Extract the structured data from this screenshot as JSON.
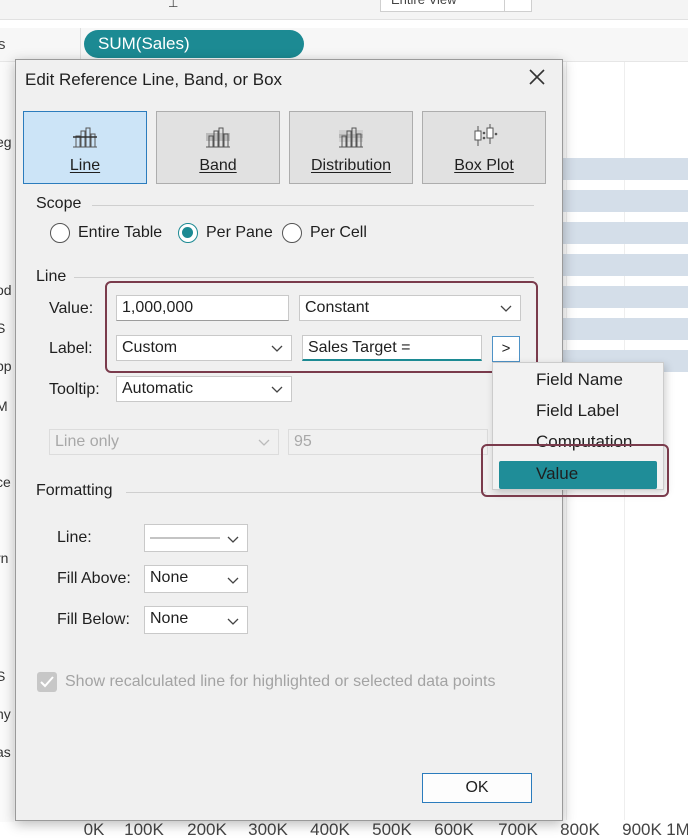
{
  "background": {
    "shelf_pill": "SUM(Sales)",
    "shelf_label_partial": "s",
    "left_labels_partial": [
      "eg",
      "od",
      "S",
      "pp",
      "M",
      "ce",
      "rn",
      "S",
      "ny",
      "as"
    ],
    "axis_ticks": [
      "0K",
      "100K",
      "200K",
      "300K",
      "400K",
      "500K",
      "600K",
      "700K",
      "800K",
      "900K",
      "1M"
    ]
  },
  "dialog": {
    "title": "Edit Reference Line, Band, or Box",
    "types": [
      {
        "label": "Line",
        "icon": "line-icon",
        "active": true
      },
      {
        "label": "Band",
        "icon": "band-icon",
        "active": false
      },
      {
        "label": "Distribution",
        "icon": "distribution-icon",
        "active": false
      },
      {
        "label": "Box Plot",
        "icon": "box-plot-icon",
        "active": false
      }
    ],
    "scope": {
      "heading": "Scope",
      "options": [
        {
          "label": "Entire Table",
          "selected": false
        },
        {
          "label": "Per Pane",
          "selected": true
        },
        {
          "label": "Per Cell",
          "selected": false
        }
      ]
    },
    "line": {
      "heading": "Line",
      "value_label": "Value:",
      "value_input": "1,000,000",
      "value_type": "Constant",
      "label_label": "Label:",
      "label_type": "Custom",
      "label_text": "Sales Target =",
      "insert_button": ">",
      "tooltip_label": "Tooltip:",
      "tooltip_value": "Automatic",
      "confidence_select": "Line only",
      "confidence_value": "95"
    },
    "formatting": {
      "heading": "Formatting",
      "line_label": "Line:",
      "fill_above_label": "Fill Above:",
      "fill_above_value": "None",
      "fill_below_label": "Fill Below:",
      "fill_below_value": "None"
    },
    "recalc_checkbox": "Show recalculated line for highlighted or selected data points",
    "ok_button": "OK"
  },
  "insert_menu": {
    "items": [
      "Field Name",
      "Field Label",
      "Computation",
      "Value"
    ],
    "selected": "Value"
  },
  "colors": {
    "accent": "#1c8a93",
    "highlight_outline": "#7a3b4c",
    "active_tab": "#cce4f7",
    "bar_fill": "#d4dee9"
  }
}
